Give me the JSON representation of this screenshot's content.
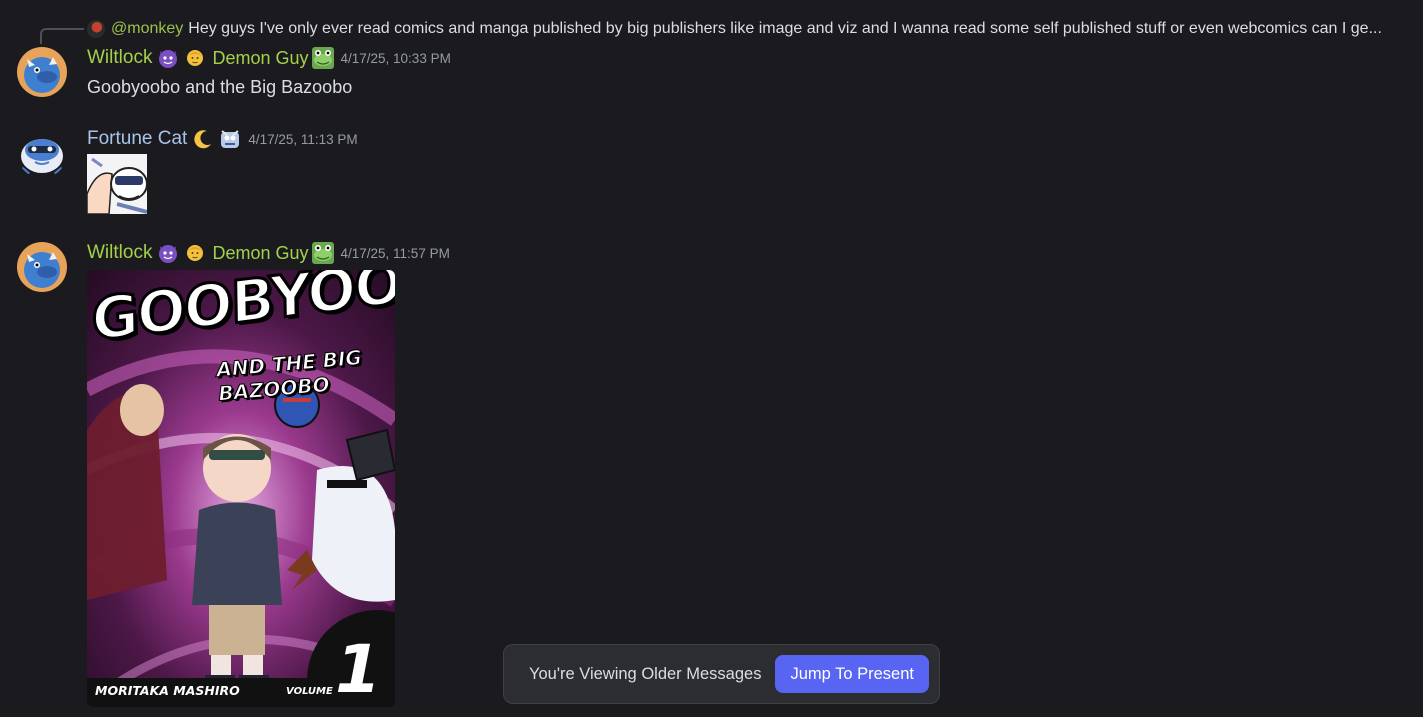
{
  "reply": {
    "author": "@monkey",
    "text": "Hey guys I've only ever read comics and manga published by big publishers like image and viz and I wanna read some self published stuff or even webcomics can I ge..."
  },
  "messages": [
    {
      "username": "Wiltlock",
      "role_tag": "Demon Guy",
      "timestamp": "4/17/25, 10:33 PM",
      "content": "Goobyoobo and the Big Bazoobo"
    },
    {
      "username": "Fortune Cat",
      "timestamp": "4/17/25, 11:13 PM",
      "content": ""
    },
    {
      "username": "Wiltlock",
      "role_tag": "Demon Guy",
      "timestamp": "4/17/25, 11:57 PM",
      "attachment": {
        "title": "GOOBYOOBO",
        "subtitle": "AND THE BIG BAZOOBO",
        "author": "MORITAKA MASHIRO",
        "volume_label": "VOLUME",
        "volume_number": "1"
      }
    }
  ],
  "older_bar": {
    "text": "You're Viewing Older Messages",
    "button": "Jump To Present"
  },
  "icons": {
    "emoji_1": "purple-demon-emoji-icon",
    "emoji_2": "person-emoji-icon",
    "emoji_3": "frog-emoji-icon",
    "emoji_4": "crescent-moon-emoji-icon",
    "emoji_5": "sticker-emoji-icon"
  },
  "colors": {
    "background": "#1b1b1f",
    "username_green": "#a3d14a",
    "username_blue": "#a9c4e9",
    "reply_author": "#9bc24a",
    "timestamp": "#949ba4",
    "button": "#5865f2"
  }
}
